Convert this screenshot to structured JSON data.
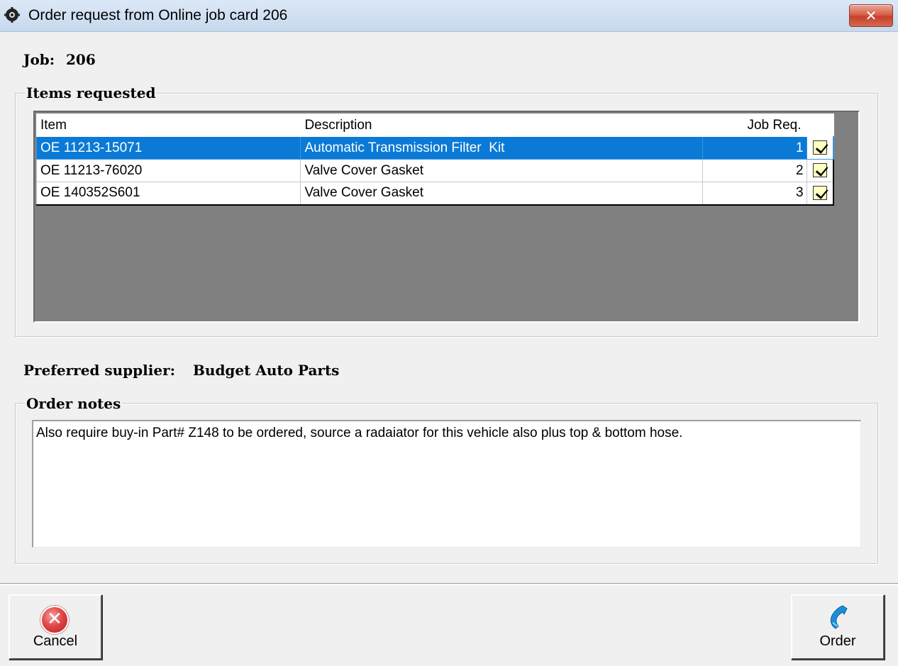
{
  "window": {
    "title": "Order request from Online job card 206",
    "close_glyph": "✕"
  },
  "job": {
    "label": "Job:",
    "value": "206"
  },
  "items_requested": {
    "group_title": "Items requested",
    "columns": {
      "item": "Item",
      "description": "Description",
      "job_req": "Job Req."
    },
    "rows": [
      {
        "item": "OE 11213-15071",
        "description": "Automatic Transmission Filter  Kit",
        "job_req": "1",
        "checked": true,
        "selected": true
      },
      {
        "item": "OE 11213-76020",
        "description": "Valve Cover Gasket",
        "job_req": "2",
        "checked": true,
        "selected": false
      },
      {
        "item": "OE 140352S601",
        "description": "Valve Cover Gasket",
        "job_req": "3",
        "checked": true,
        "selected": false
      }
    ]
  },
  "supplier": {
    "label": "Preferred supplier:",
    "value": "Budget Auto Parts"
  },
  "order_notes": {
    "group_title": "Order notes",
    "text": "Also require buy-in Part# Z148 to be ordered, source a radaiator for this vehicle also plus top & bottom hose."
  },
  "buttons": {
    "cancel_label": "Cancel",
    "cancel_glyph": "✕",
    "order_label": "Order"
  },
  "icons": {
    "app": "app-gear-icon",
    "cancel": "cancel-circle-icon",
    "order": "phone-icon"
  },
  "colors": {
    "selection": "#0a7ad6",
    "grid_background": "#808080",
    "close_button": "#c6402a",
    "checkbox_fill": "#ffffc0"
  }
}
